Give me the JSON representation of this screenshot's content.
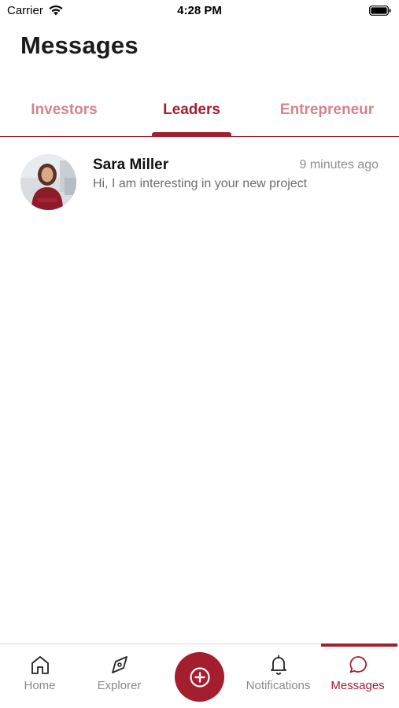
{
  "status_bar": {
    "carrier": "Carrier",
    "time": "4:28 PM",
    "wifi_icon": "wifi-icon",
    "battery_icon": "battery-icon"
  },
  "header": {
    "title": "Messages"
  },
  "tabs": [
    {
      "label": "Investors",
      "active": false
    },
    {
      "label": "Leaders",
      "active": true
    },
    {
      "label": "Entrepreneur",
      "active": false
    }
  ],
  "messages": [
    {
      "sender": "Sara Miller",
      "time_ago": "9 minutes ago",
      "preview": "Hi, I am interesting in your new project",
      "avatar_icon": "avatar-photo"
    }
  ],
  "bottom_nav": {
    "items": [
      {
        "label": "Home",
        "icon": "home-icon",
        "active": false
      },
      {
        "label": "Explorer",
        "icon": "compass-icon",
        "active": false
      },
      {
        "label": "Notifications",
        "icon": "bell-icon",
        "active": false
      },
      {
        "label": "Messages",
        "icon": "chat-bubble-icon",
        "active": true
      }
    ],
    "fab_icon": "plus-circle-icon"
  },
  "colors": {
    "accent": "#a51e2d",
    "accent_light": "#d5838c",
    "muted_text": "#8a8a8a"
  }
}
